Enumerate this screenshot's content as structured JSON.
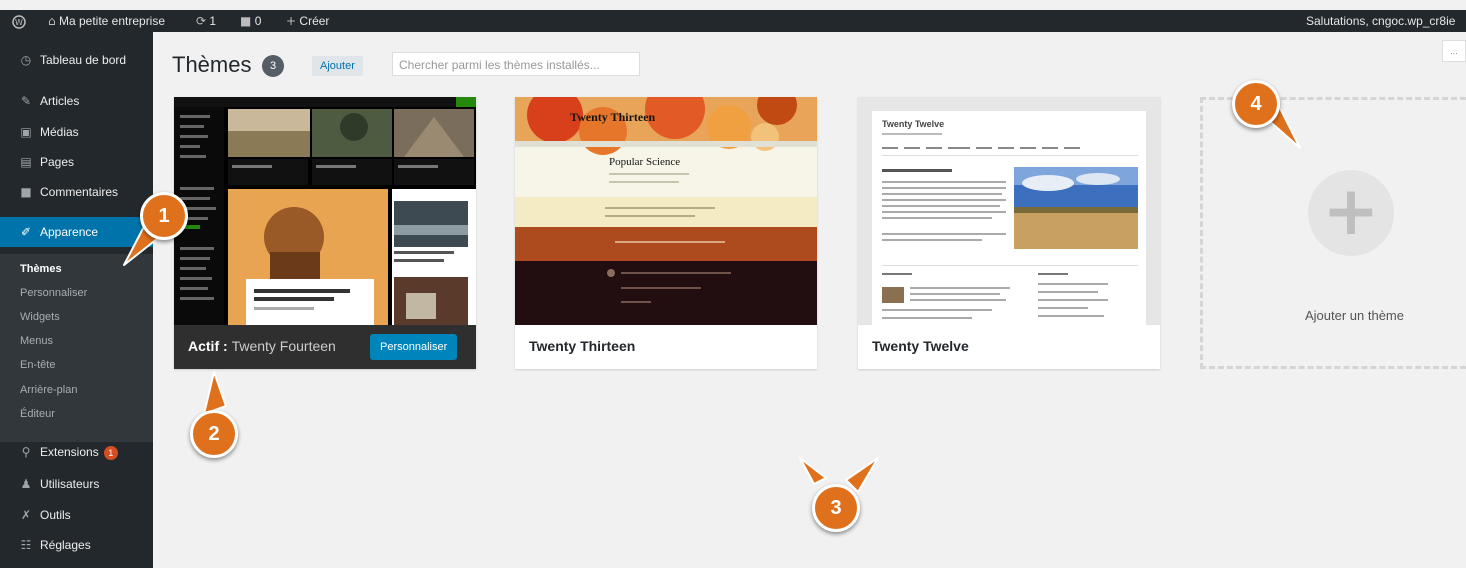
{
  "adminbar": {
    "wp_logo_icon": "wordpress-icon",
    "home_icon": "home-icon",
    "site_name": "Ma petite entreprise",
    "updates_icon": "refresh-icon",
    "updates_count": "1",
    "comments_icon": "comment-icon",
    "comments_count": "0",
    "new_icon": "plus-icon",
    "new_label": "Créer",
    "user": "Salutations, cngoc.wp_cr8ie"
  },
  "sidebar": {
    "items": [
      {
        "icon": "dashboard-icon",
        "label": "Tableau de bord"
      },
      {
        "icon": "pin-icon",
        "label": "Articles"
      },
      {
        "icon": "media-icon",
        "label": "Médias"
      },
      {
        "icon": "page-icon",
        "label": "Pages"
      },
      {
        "icon": "comment-icon",
        "label": "Commentaires"
      },
      {
        "icon": "brush-icon",
        "label": "Apparence"
      },
      {
        "icon": "plugin-icon",
        "label": "Extensions",
        "badge": "1"
      },
      {
        "icon": "user-icon",
        "label": "Utilisateurs"
      },
      {
        "icon": "wrench-icon",
        "label": "Outils"
      },
      {
        "icon": "settings-icon",
        "label": "Réglages"
      }
    ],
    "submenu": [
      "Thèmes",
      "Personnaliser",
      "Widgets",
      "Menus",
      "En-tête",
      "Arrière-plan",
      "Éditeur"
    ]
  },
  "main": {
    "title": "Thèmes",
    "count": "3",
    "add_new": "Ajouter",
    "search_placeholder": "Chercher parmi les thèmes installés...",
    "screen_options": "..."
  },
  "themes": [
    {
      "prefix": "Actif :",
      "name": "Twenty Fourteen",
      "active": true,
      "action": "Personnaliser"
    },
    {
      "name": "Twenty Thirteen",
      "active": false
    },
    {
      "name": "Twenty Twelve",
      "active": false
    }
  ],
  "twentythirteen_preview": {
    "site_title": "Twenty Thirteen",
    "post_title": "Popular Science"
  },
  "twentytwelve_preview": {
    "site_title": "Twenty Twelve"
  },
  "add_theme": {
    "label": "Ajouter un thème"
  },
  "callouts": [
    "1",
    "2",
    "3",
    "4"
  ],
  "colors": {
    "admin_dark": "#23282d",
    "accent": "#0073aa",
    "callout": "#e0711c"
  }
}
